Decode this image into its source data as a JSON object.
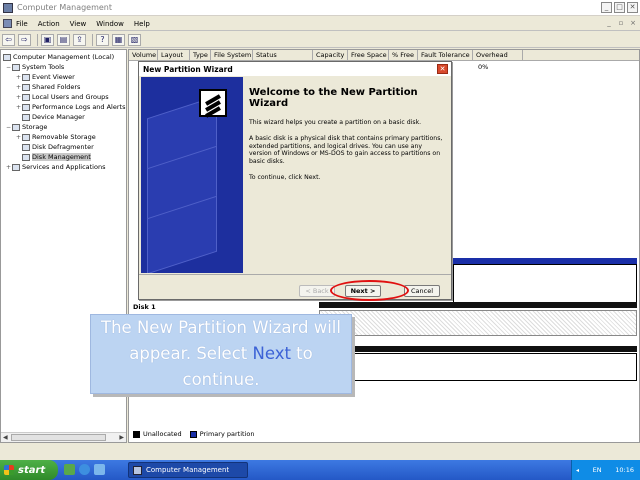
{
  "window": {
    "title": "Computer Management",
    "controls": [
      "_",
      "□",
      "✕"
    ]
  },
  "menu": {
    "items": [
      "File",
      "Action",
      "View",
      "Window",
      "Help"
    ],
    "mdi_controls": [
      "_",
      "▫",
      "×"
    ]
  },
  "toolbar": {
    "buttons": [
      "back-icon",
      "forward-icon",
      "up-folder-icon",
      "show-hide-tree-icon",
      "export-icon",
      "help-icon",
      "properties-icon",
      "refresh-icon"
    ]
  },
  "tree": {
    "items": [
      {
        "label": "Computer Management (Local)",
        "toggle": "",
        "level": 0
      },
      {
        "label": "System Tools",
        "toggle": "−",
        "level": 1
      },
      {
        "label": "Event Viewer",
        "toggle": "+",
        "level": 2
      },
      {
        "label": "Shared Folders",
        "toggle": "+",
        "level": 2
      },
      {
        "label": "Local Users and Groups",
        "toggle": "+",
        "level": 2
      },
      {
        "label": "Performance Logs and Alerts",
        "toggle": "+",
        "level": 2
      },
      {
        "label": "Device Manager",
        "toggle": "",
        "level": 2
      },
      {
        "label": "Storage",
        "toggle": "−",
        "level": 1
      },
      {
        "label": "Removable Storage",
        "toggle": "+",
        "level": 2
      },
      {
        "label": "Disk Defragmenter",
        "toggle": "",
        "level": 2
      },
      {
        "label": "Disk Management",
        "toggle": "",
        "level": 2,
        "selected": true
      },
      {
        "label": "Services and Applications",
        "toggle": "+",
        "level": 1
      }
    ]
  },
  "volume_list": {
    "columns": [
      "Volume",
      "Layout",
      "Type",
      "File System",
      "Status",
      "Capacity",
      "Free Space",
      "% Free",
      "Fault Tolerance",
      "Overhead"
    ],
    "visible_overhead": "0%"
  },
  "disk_view": {
    "disk1_label": "Disk 1"
  },
  "legend": {
    "items": [
      {
        "label": "Unallocated",
        "color": "#000000"
      },
      {
        "label": "Primary partition",
        "color": "#1a2fa8"
      }
    ]
  },
  "wizard": {
    "title": "New Partition Wizard",
    "close": "✕",
    "heading": "Welcome to the New Partition Wizard",
    "para1": "This wizard helps you create a partition on a basic disk.",
    "para2": "A basic disk is a physical disk that contains primary partitions, extended partitions, and logical drives. You can use any version of Windows or MS-DOS to gain access to partitions on basic disks.",
    "para3": "To continue, click Next.",
    "back_label": "< Back",
    "next_label": "Next >",
    "cancel_label": "Cancel"
  },
  "callout": {
    "text_before": "The New Partition Wizard will appear. Select ",
    "highlight": "Next",
    "text_after": " to continue.",
    "highlight_color": "#3c62d6"
  },
  "taskbar": {
    "start_label": "start",
    "task_label": "Computer Management",
    "language": "EN",
    "clock": "10:16"
  }
}
